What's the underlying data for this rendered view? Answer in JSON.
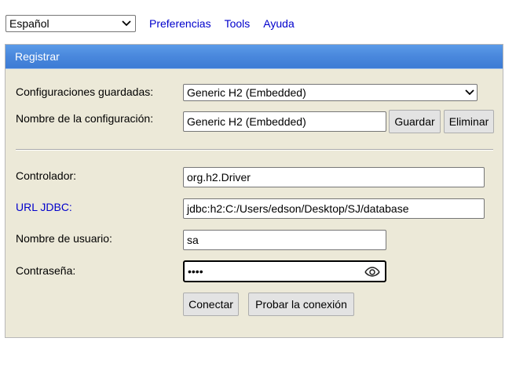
{
  "top": {
    "language_selected": "Español",
    "links": [
      "Preferencias",
      "Tools",
      "Ayuda"
    ]
  },
  "panel": {
    "title": "Registrar",
    "saved_settings_label": "Configuraciones guardadas:",
    "saved_settings_value": "Generic H2 (Embedded)",
    "setting_name_label": "Nombre de la configuración:",
    "setting_name_value": "Generic H2 (Embedded)",
    "save_button": "Guardar",
    "remove_button": "Eliminar",
    "driver_label": "Controlador:",
    "driver_value": "org.h2.Driver",
    "jdbc_url_label": "URL JDBC:",
    "jdbc_url_value": "jdbc:h2:C:/Users/edson/Desktop/SJ/database",
    "user_label": "Nombre de usuario:",
    "user_value": "sa",
    "password_label": "Contraseña:",
    "password_value": "••••",
    "connect_button": "Conectar",
    "test_button": "Probar la conexión"
  },
  "icons": {
    "dropdown": "chevron-down-icon",
    "password_reveal": "eye-icon"
  }
}
